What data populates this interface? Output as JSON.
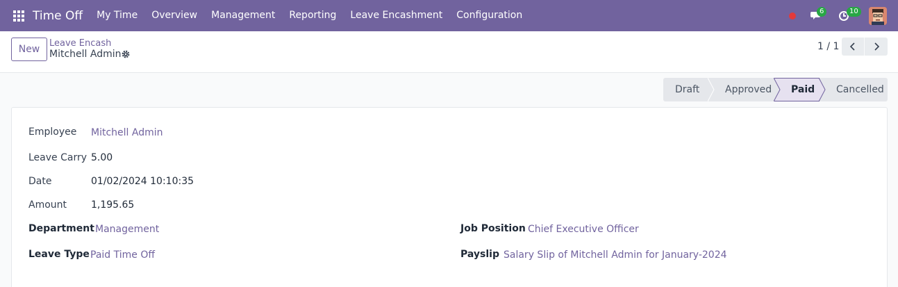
{
  "navbar": {
    "app_title": "Time Off",
    "menu": [
      "My Time",
      "Overview",
      "Management",
      "Reporting",
      "Leave Encashment",
      "Configuration"
    ],
    "messages_count": "6",
    "activities_count": "10",
    "record_color": "#e33a3a",
    "bar_color": "#71639e"
  },
  "control_panel": {
    "new_label": "New",
    "breadcrumb_parent": "Leave Encash",
    "breadcrumb_current": "Mitchell Admin",
    "pager": "1 / 1"
  },
  "status": {
    "stages": [
      "Draft",
      "Approved",
      "Paid",
      "Cancelled"
    ],
    "active": "Paid"
  },
  "form": {
    "employee_label": "Employee",
    "employee_value": "Mitchell Admin",
    "leave_carry_label": "Leave Carry",
    "leave_carry_value": "5.00",
    "date_label": "Date",
    "date_value": "01/02/2024 10:10:35",
    "amount_label": "Amount",
    "amount_value": "1,195.65",
    "department_label": "Department",
    "department_value": "Management",
    "leave_type_label": "Leave Type",
    "leave_type_value": "Paid Time Off",
    "job_position_label": "Job Position",
    "job_position_value": "Chief Executive Officer",
    "payslip_label": "Payslip",
    "payslip_value": "Salary Slip of Mitchell Admin for January-2024"
  }
}
